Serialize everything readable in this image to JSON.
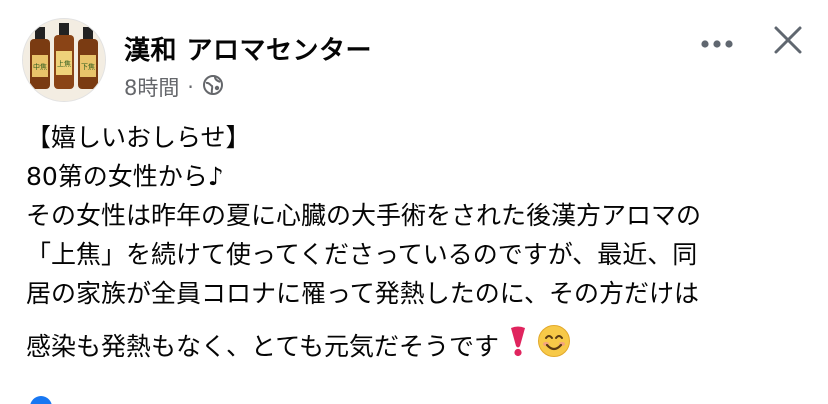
{
  "post": {
    "page_name": "漢和 アロマセンター",
    "time": "8時間",
    "separator": "·",
    "icons": {
      "audience": "globe-icon",
      "more": "more-horizontal-icon",
      "close": "close-icon"
    },
    "avatar_labels": [
      "中焦",
      "上焦",
      "下焦"
    ],
    "lines": [
      "【嬉しいおしらせ】",
      "80第の女性から♪",
      "その女性は昨年の夏に心臓の大手術をされた後漢方アロマの",
      "「上焦」を続けて使ってくださっているのですが、最近、同",
      "居の家族が全員コロナに罹って発熱したのに、その方だけは",
      "感染も発熱もなく、とても元気だそうです"
    ],
    "trailing_emoji": [
      "heavy-exclamation-emoji",
      "smiling-face-emoji"
    ],
    "colors": {
      "text": "#050505",
      "secondary": "#65676b",
      "bottle": "#7a3b12",
      "label": "#e9c46a",
      "exclamation": "#e0245e",
      "smile": "#f7c948"
    }
  }
}
